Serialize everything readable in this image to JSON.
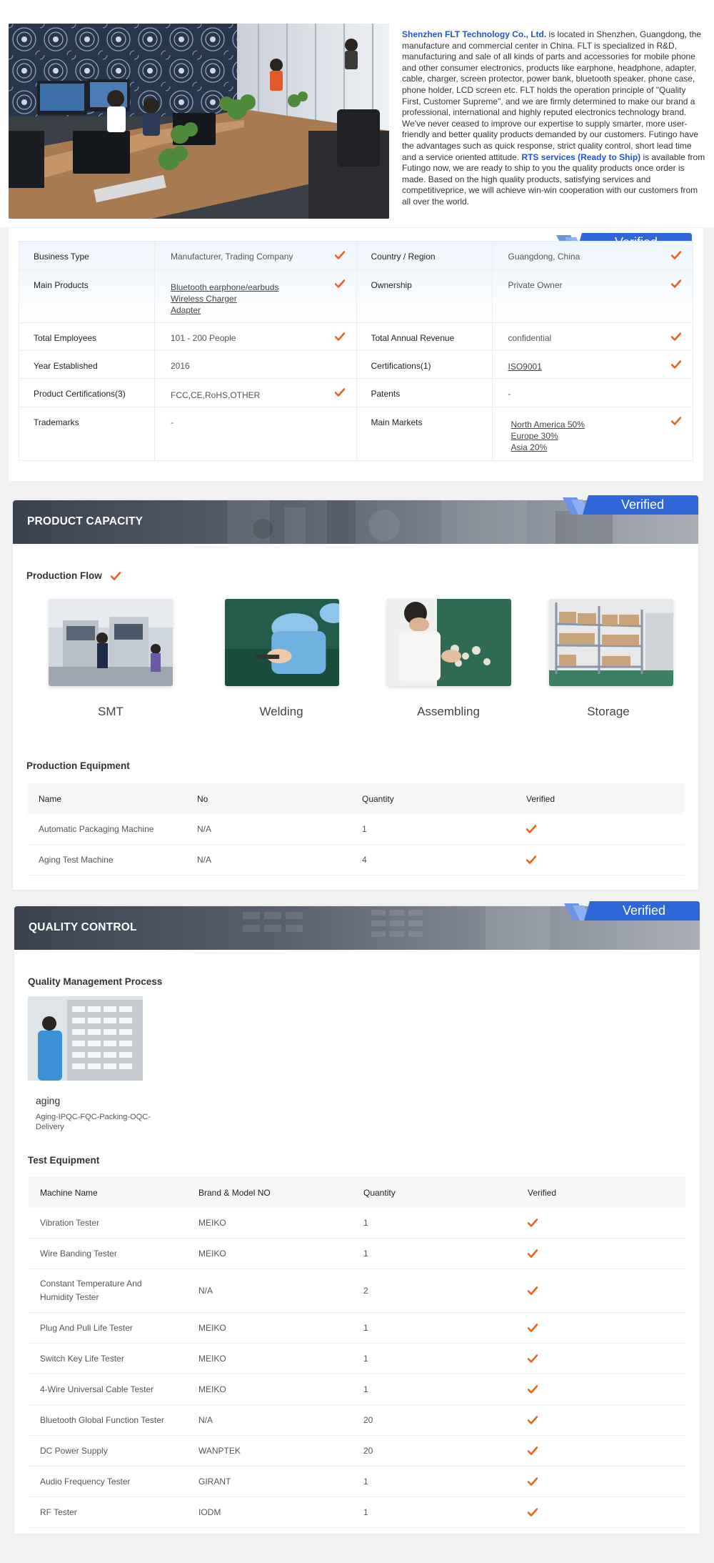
{
  "intro": {
    "company_name": "Shenzhen FLT Technology Co., Ltd.",
    "text_1": " is located in Shenzhen, Guangdong, the manufacture and commercial center in China. FLT is specialized in R&D, manufacturing and sale of all kinds of parts and accessories for mobile phone and other consumer electronics, products like earphone, headphone, adapter, cable, charger, screen protector, power bank, bluetooth speaker, phone case, phone holder, LCD screen etc. FLT holds the operation principle of \"Quality First, Customer Supreme\", and we are firmly determined to make our brand a professional, international and highly reputed electronics technology brand. We've never ceased to improve our expertise to supply smarter, more user-friendly and better quality products demanded by our customers. Futingo have the advantages such as quick response, strict quality control, short lead time and a service oriented attitude. ",
    "rts": "RTS services (Ready to Ship)",
    "text_2": " is available from Futingo now, we are ready to ship to you the quality products once order is made. Based on the high quality products, satisfying services and competitiveprice, we will achieve win-win cooperation with our customers from all over the world."
  },
  "verified_label": "Verified",
  "company_info": {
    "rows": [
      [
        {
          "label": "Business Type",
          "values": [
            "Manufacturer, Trading Company"
          ],
          "links": false,
          "verified": true
        },
        {
          "label": "Country / Region",
          "values": [
            "Guangdong, China"
          ],
          "links": false,
          "verified": true
        }
      ],
      [
        {
          "label": "Main Products",
          "values": [
            "Bluetooth earphone/earbuds",
            "Wireless Charger",
            "Adapter"
          ],
          "links": true,
          "verified": true
        },
        {
          "label": "Ownership",
          "values": [
            "Private Owner"
          ],
          "links": false,
          "verified": true
        }
      ],
      [
        {
          "label": "Total Employees",
          "values": [
            "101 - 200 People"
          ],
          "links": false,
          "verified": true
        },
        {
          "label": "Total Annual Revenue",
          "values": [
            "confidential"
          ],
          "links": false,
          "verified": true
        }
      ],
      [
        {
          "label": "Year Established",
          "values": [
            "2016"
          ],
          "links": false,
          "verified": false
        },
        {
          "label": "Certifications(1)",
          "values": [
            "ISO9001"
          ],
          "links": true,
          "verified": true
        }
      ],
      [
        {
          "label": "Product Certifications(3)",
          "values": [
            "FCC,CE,RoHS,OTHER"
          ],
          "links": false,
          "verified": true
        },
        {
          "label": "Patents",
          "values": [
            "-"
          ],
          "links": false,
          "verified": false
        }
      ],
      [
        {
          "label": "Trademarks",
          "values": [
            "-"
          ],
          "links": false,
          "verified": false
        },
        {
          "label": "Main Markets",
          "values": [
            "North America 50%",
            "Europe 30%",
            "Asia 20%"
          ],
          "links": true,
          "verified": true
        }
      ]
    ]
  },
  "product_capacity": {
    "title": "PRODUCT CAPACITY",
    "flow_title": "Production Flow",
    "flow_items": [
      {
        "label": "SMT",
        "icon": "smt-photo"
      },
      {
        "label": "Welding",
        "icon": "welding-photo"
      },
      {
        "label": "Assembling",
        "icon": "assembling-photo"
      },
      {
        "label": "Storage",
        "icon": "storage-photo"
      }
    ],
    "equipment_title": "Production Equipment",
    "equipment_headers": [
      "Name",
      "No",
      "Quantity",
      "Verified"
    ],
    "equipment_rows": [
      [
        "Automatic Packaging Machine",
        "N/A",
        "1"
      ],
      [
        "Aging Test Machine",
        "N/A",
        "4"
      ]
    ]
  },
  "quality_control": {
    "title": "QUALITY CONTROL",
    "process_title": "Quality Management Process",
    "process_name": "aging",
    "process_steps": "Aging-IPQC-FQC-Packing-OQC-Delivery",
    "test_title": "Test Equipment",
    "test_headers": [
      "Machine Name",
      "Brand & Model NO",
      "Quantity",
      "Verified"
    ],
    "test_rows": [
      [
        "Vibration Tester",
        "MEIKO",
        "1"
      ],
      [
        "Wire Banding Tester",
        "MEIKO",
        "1"
      ],
      [
        "Constant Temperature And Humidity Tester",
        "N/A",
        "2"
      ],
      [
        "Plug And Pull Life Tester",
        "MEIKO",
        "1"
      ],
      [
        "Switch Key Life Tester",
        "MEIKO",
        "1"
      ],
      [
        "4-Wire Universal Cable Tester",
        "MEIKO",
        "1"
      ],
      [
        "Bluetooth Global Function Tester",
        "N/A",
        "20"
      ],
      [
        "DC Power Supply",
        "WANPTEK",
        "20"
      ],
      [
        "Audio Frequency Tester",
        "GIRANT",
        "1"
      ],
      [
        "RF Tester",
        "IODM",
        "1"
      ]
    ]
  },
  "colors": {
    "accent_blue": "#2354d3",
    "check_orange": "#e8641b",
    "badge_blue": "#2f67d8"
  }
}
